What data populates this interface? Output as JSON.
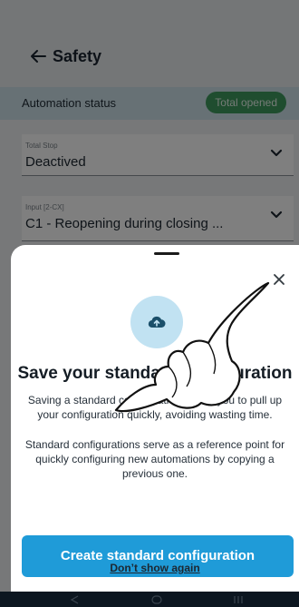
{
  "header": {
    "title": "Safety",
    "back_icon": "arrow-left-icon"
  },
  "automation": {
    "label": "Automation status",
    "badge": "Total opened",
    "badge_color": "#3e9a5e"
  },
  "fields": [
    {
      "caption": "Total Stop",
      "value": "Deactived"
    },
    {
      "caption": "Input [2-CX]",
      "value": "C1 - Reopening during closing ..."
    }
  ],
  "sheet": {
    "icon": "cloud-upload-icon",
    "title": "Save your standard configuration",
    "p1": "Saving a standard configuration allows you to pull up your configuration quickly, avoiding wasting time.",
    "p2": "Standard configurations serve as a reference point for quickly configuring new automations by copying a previous one.",
    "primary_label": "Create standard configuration",
    "secondary_label": "Don’t show again",
    "accent": "#1f9bd8"
  }
}
